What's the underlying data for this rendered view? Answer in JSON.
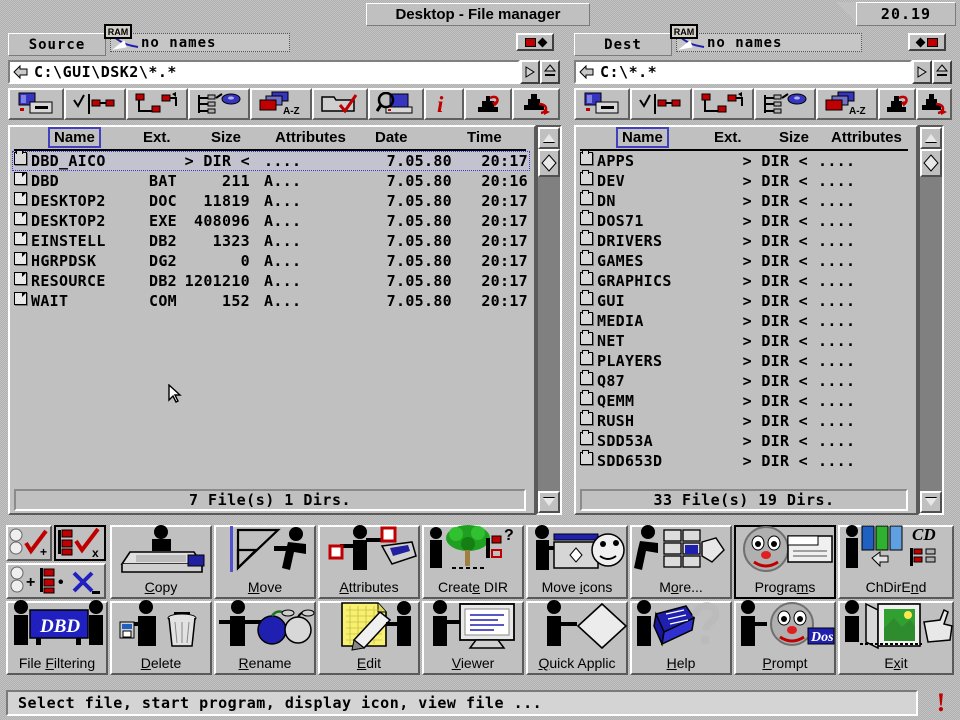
{
  "window": {
    "title": "Desktop - File manager",
    "clock": "20.19"
  },
  "source_panel": {
    "label": "Source",
    "volume_tag": "RAM",
    "volume_name": "no names",
    "path": "C:\\GUI\\DSK2\\*.*",
    "columns": [
      "Name",
      "Ext.",
      "Size",
      "Attributes",
      "Date",
      "Time"
    ],
    "status": "7 File(s) 1 Dirs.",
    "rows": [
      {
        "icon": "folder-icon",
        "name": "DBD_AICO",
        "ext": "",
        "size": "> DIR <",
        "attr": "....",
        "date": "7.05.80",
        "time": "20:17",
        "selected": true
      },
      {
        "icon": "file-icon",
        "name": "DBD",
        "ext": "BAT",
        "size": "211",
        "attr": "A...",
        "date": "7.05.80",
        "time": "20:16",
        "selected": false
      },
      {
        "icon": "file-icon",
        "name": "DESKTOP2",
        "ext": "DOC",
        "size": "11819",
        "attr": "A...",
        "date": "7.05.80",
        "time": "20:17",
        "selected": false
      },
      {
        "icon": "file-icon",
        "name": "DESKTOP2",
        "ext": "EXE",
        "size": "408096",
        "attr": "A...",
        "date": "7.05.80",
        "time": "20:17",
        "selected": false
      },
      {
        "icon": "file-icon",
        "name": "EINSTELL",
        "ext": "DB2",
        "size": "1323",
        "attr": "A...",
        "date": "7.05.80",
        "time": "20:17",
        "selected": false
      },
      {
        "icon": "file-icon",
        "name": "HGRPDSK",
        "ext": "DG2",
        "size": "0",
        "attr": "A...",
        "date": "7.05.80",
        "time": "20:17",
        "selected": false
      },
      {
        "icon": "file-icon",
        "name": "RESOURCE",
        "ext": "DB2",
        "size": "1201210",
        "attr": "A...",
        "date": "7.05.80",
        "time": "20:17",
        "selected": false
      },
      {
        "icon": "file-icon",
        "name": "WAIT",
        "ext": "COM",
        "size": "152",
        "attr": "A...",
        "date": "7.05.80",
        "time": "20:17",
        "selected": false
      }
    ]
  },
  "dest_panel": {
    "label": "Dest",
    "volume_tag": "RAM",
    "volume_name": "no names",
    "path": "C:\\*.*",
    "columns": [
      "Name",
      "Ext.",
      "Size",
      "Attributes"
    ],
    "status": "33 File(s) 19 Dirs.",
    "rows": [
      {
        "icon": "folder-icon",
        "name": "APPS",
        "ext": "",
        "size": "> DIR <",
        "attr": "...."
      },
      {
        "icon": "folder-icon",
        "name": "DEV",
        "ext": "",
        "size": "> DIR <",
        "attr": "...."
      },
      {
        "icon": "folder-icon",
        "name": "DN",
        "ext": "",
        "size": "> DIR <",
        "attr": "...."
      },
      {
        "icon": "folder-icon",
        "name": "DOS71",
        "ext": "",
        "size": "> DIR <",
        "attr": "...."
      },
      {
        "icon": "folder-icon",
        "name": "DRIVERS",
        "ext": "",
        "size": "> DIR <",
        "attr": "...."
      },
      {
        "icon": "folder-icon",
        "name": "GAMES",
        "ext": "",
        "size": "> DIR <",
        "attr": "...."
      },
      {
        "icon": "folder-icon",
        "name": "GRAPHICS",
        "ext": "",
        "size": "> DIR <",
        "attr": "...."
      },
      {
        "icon": "folder-icon",
        "name": "GUI",
        "ext": "",
        "size": "> DIR <",
        "attr": "...."
      },
      {
        "icon": "folder-icon",
        "name": "MEDIA",
        "ext": "",
        "size": "> DIR <",
        "attr": "...."
      },
      {
        "icon": "folder-icon",
        "name": "NET",
        "ext": "",
        "size": "> DIR <",
        "attr": "...."
      },
      {
        "icon": "folder-icon",
        "name": "PLAYERS",
        "ext": "",
        "size": "> DIR <",
        "attr": "...."
      },
      {
        "icon": "folder-icon",
        "name": "Q87",
        "ext": "",
        "size": "> DIR <",
        "attr": "...."
      },
      {
        "icon": "folder-icon",
        "name": "QEMM",
        "ext": "",
        "size": "> DIR <",
        "attr": "...."
      },
      {
        "icon": "folder-icon",
        "name": "RUSH",
        "ext": "",
        "size": "> DIR <",
        "attr": "...."
      },
      {
        "icon": "folder-icon",
        "name": "SDD53A",
        "ext": "",
        "size": "> DIR <",
        "attr": "...."
      },
      {
        "icon": "folder-icon",
        "name": "SDD653D",
        "ext": "",
        "size": "> DIR <",
        "attr": "...."
      }
    ]
  },
  "source_toolbar": [
    {
      "icon": "drive-computer-icon"
    },
    {
      "icon": "sort-check-icon"
    },
    {
      "icon": "tree-branch-icon"
    },
    {
      "icon": "tree-disk-icon"
    },
    {
      "icon": "sort-az-icon"
    },
    {
      "icon": "folder-check-icon"
    },
    {
      "icon": "find-computer-icon"
    },
    {
      "icon": "info-icon"
    },
    {
      "icon": "swap-panels-icon"
    },
    {
      "icon": "refresh-panel-icon"
    }
  ],
  "dest_toolbar": [
    {
      "icon": "drive-computer-icon"
    },
    {
      "icon": "sort-check-icon"
    },
    {
      "icon": "tree-branch-icon"
    },
    {
      "icon": "tree-disk-icon"
    },
    {
      "icon": "sort-az-icon"
    },
    {
      "icon": "swap-panels-icon"
    },
    {
      "icon": "refresh-panel-icon"
    }
  ],
  "buttons": [
    {
      "id": "select-add",
      "label": "",
      "icon": "select-check-plus-icon",
      "focused": false
    },
    {
      "id": "select-remove",
      "label": "",
      "icon": "deselect-check-x-icon",
      "focused": false
    },
    {
      "id": "select-invert",
      "label": "",
      "icon": "select-invert-icon",
      "focused": false
    },
    {
      "id": "copy",
      "label": "Copy",
      "icon": "copy-box-icon",
      "focused": false,
      "accel": "C"
    },
    {
      "id": "move",
      "label": "Move",
      "icon": "move-push-icon",
      "focused": false,
      "accel": "M"
    },
    {
      "id": "attributes",
      "label": "Attributes",
      "icon": "attributes-icon",
      "focused": false,
      "accel": "A"
    },
    {
      "id": "create-dir",
      "label": "Create DIR",
      "icon": "create-dir-tree-icon",
      "focused": false,
      "accel": "e"
    },
    {
      "id": "move-icons",
      "label": "Move icons",
      "icon": "move-icons-icon",
      "focused": false,
      "accel": "i"
    },
    {
      "id": "more",
      "label": "More...",
      "icon": "more-icon",
      "focused": false,
      "accel": "o"
    },
    {
      "id": "programs",
      "label": "Programs",
      "icon": "programs-face-icon",
      "focused": true,
      "accel": "m"
    },
    {
      "id": "chdirend",
      "label": "ChDirEnd",
      "icon": "chdir-end-icon",
      "focused": false,
      "accel": "n"
    },
    {
      "id": "file-filtering",
      "label": "File Filtering",
      "icon": "file-filtering-icon",
      "focused": false,
      "accel": "F"
    },
    {
      "id": "delete",
      "label": "Delete",
      "icon": "delete-trash-icon",
      "focused": false,
      "accel": "D"
    },
    {
      "id": "rename",
      "label": "Rename",
      "icon": "rename-fruit-icon",
      "focused": false,
      "accel": "R"
    },
    {
      "id": "edit",
      "label": "Edit",
      "icon": "edit-pencil-icon",
      "focused": false,
      "accel": "E"
    },
    {
      "id": "viewer",
      "label": "Viewer",
      "icon": "viewer-monitor-icon",
      "focused": false,
      "accel": "V"
    },
    {
      "id": "quick-applic",
      "label": "Quick Applic",
      "icon": "quick-applic-icon",
      "focused": false,
      "accel": "Q"
    },
    {
      "id": "help",
      "label": "Help",
      "icon": "help-book-icon",
      "focused": false,
      "accel": "H"
    },
    {
      "id": "prompt",
      "label": "Prompt",
      "icon": "prompt-dos-icon",
      "focused": false,
      "accel": "P"
    },
    {
      "id": "exit",
      "label": "Exit",
      "icon": "exit-door-icon",
      "focused": false,
      "accel": "x"
    }
  ],
  "statusbar": {
    "message": "Select file, start program, display icon, view file ...",
    "alert_icon": "exclamation-icon"
  },
  "colors": {
    "face": "#c0c0c0",
    "accent_red": "#c00000",
    "accent_blue": "#0000a0",
    "selection_border": "#4040c0"
  }
}
